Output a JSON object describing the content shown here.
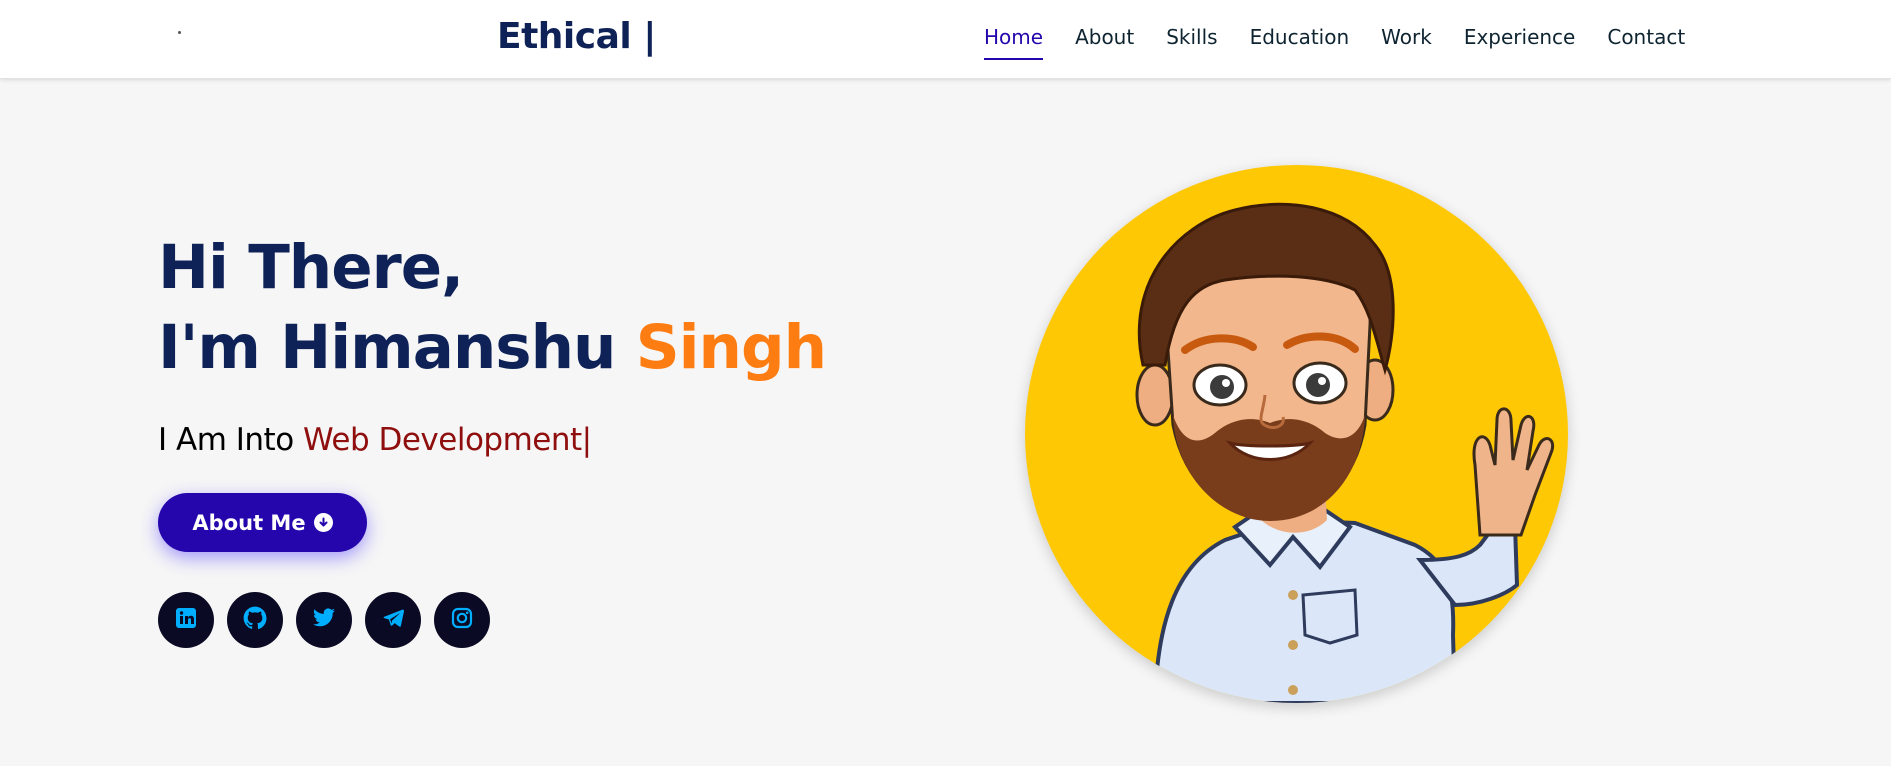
{
  "header": {
    "brand": "Ethical |",
    "nav": [
      "Home",
      "About",
      "Skills",
      "Education",
      "Work",
      "Experience",
      "Contact"
    ],
    "active": "Home"
  },
  "hero": {
    "line1": "Hi There,",
    "line2_name": "I'm Himanshu ",
    "line2_accent": "Singh",
    "typing_prefix": "I Am Into ",
    "typing_role": "Web Development|",
    "button_label": "About Me",
    "socials": [
      "linkedin-icon",
      "github-icon",
      "twitter-icon",
      "telegram-icon",
      "instagram-icon"
    ]
  },
  "colors": {
    "brand": "#0e2257",
    "accent": "#fe7d12",
    "role": "#8f0e0e",
    "button": "#2506ad",
    "social_bg": "#0b0a24",
    "social_icon": "#00aeff",
    "avatar_bg": "#ffc805"
  }
}
